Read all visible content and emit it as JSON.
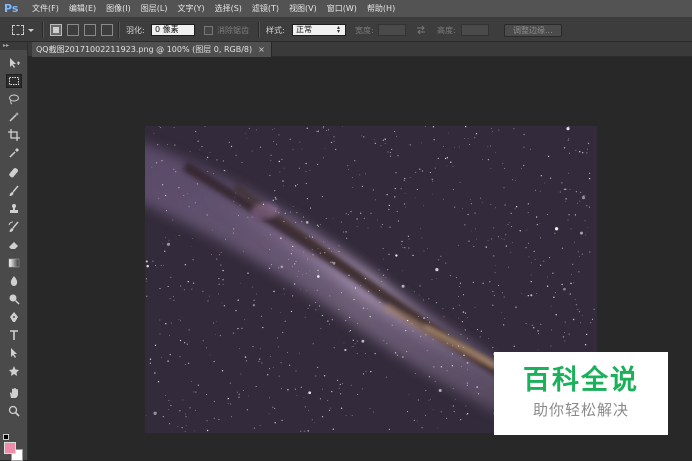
{
  "app": {
    "logo": "Ps"
  },
  "menu": [
    "文件(F)",
    "编辑(E)",
    "图像(I)",
    "图层(L)",
    "文字(Y)",
    "选择(S)",
    "滤镜(T)",
    "视图(V)",
    "窗口(W)",
    "帮助(H)"
  ],
  "options": {
    "feather_label": "羽化:",
    "feather_value": "0 像素",
    "antialias_label": "消除锯齿",
    "style_label": "样式:",
    "style_value": "正常",
    "width_label": "宽度:",
    "height_label": "高度:",
    "refine_edge_button": "调整边缘..."
  },
  "document": {
    "tab_title": "QQ截图20171002211923.png @ 100% (图层 0, RGB/8)",
    "close_glyph": "×"
  },
  "watermark": {
    "title": "百科全说",
    "subtitle": "助你轻松解决"
  },
  "colors": {
    "foreground": "#f08caa",
    "background": "#ffffff",
    "watermark_green": "#1bb05a"
  },
  "tools": [
    "move-tool",
    "rectangular-marquee-tool",
    "lasso-tool",
    "magic-wand-tool",
    "crop-tool",
    "eyedropper-tool",
    "healing-brush-tool",
    "brush-tool",
    "clone-stamp-tool",
    "history-brush-tool",
    "eraser-tool",
    "gradient-tool",
    "blur-tool",
    "dodge-tool",
    "pen-tool",
    "type-tool",
    "path-selection-tool",
    "custom-shape-tool",
    "hand-tool",
    "zoom-tool"
  ]
}
